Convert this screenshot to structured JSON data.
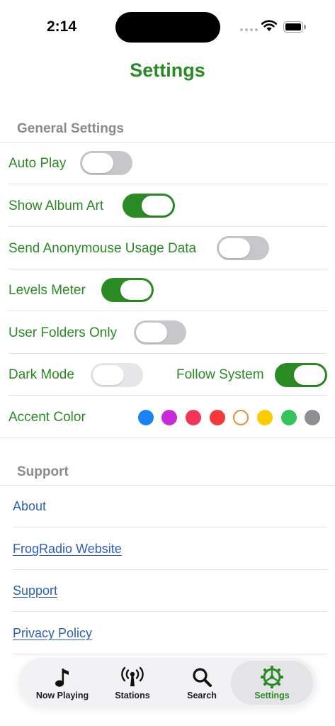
{
  "status_bar": {
    "time": "2:14"
  },
  "page_title": "Settings",
  "general": {
    "header": "General Settings",
    "auto_play": {
      "label": "Auto Play",
      "on": false
    },
    "show_album_art": {
      "label": "Show Album Art",
      "on": true
    },
    "usage_data": {
      "label": "Send Anonymouse Usage Data",
      "on": false
    },
    "levels_meter": {
      "label": "Levels Meter",
      "on": true
    },
    "user_folders_only": {
      "label": "User Folders Only",
      "on": false
    },
    "dark_mode": {
      "label": "Dark Mode",
      "on": false
    },
    "follow_system": {
      "label": "Follow System",
      "on": true
    },
    "accent_color": {
      "label": "Accent Color",
      "colors": [
        "#1a84f5",
        "#c72ad8",
        "#f2365a",
        "#f5383c",
        "#f08a2d",
        "#fccb00",
        "#34c55a",
        "#8e8e93"
      ],
      "selected": "#f08a2d"
    }
  },
  "support": {
    "header": "Support",
    "about": "About",
    "website": "FrogRadio Website",
    "support": "Support",
    "privacy": "Privacy Policy"
  },
  "tabbar": {
    "now_playing": "Now Playing",
    "stations": "Stations",
    "search": "Search",
    "settings": "Settings"
  },
  "colors": {
    "accent": "#2a8a24",
    "link": "#2c5fbd",
    "toggle_off": "#c7c7cb"
  }
}
